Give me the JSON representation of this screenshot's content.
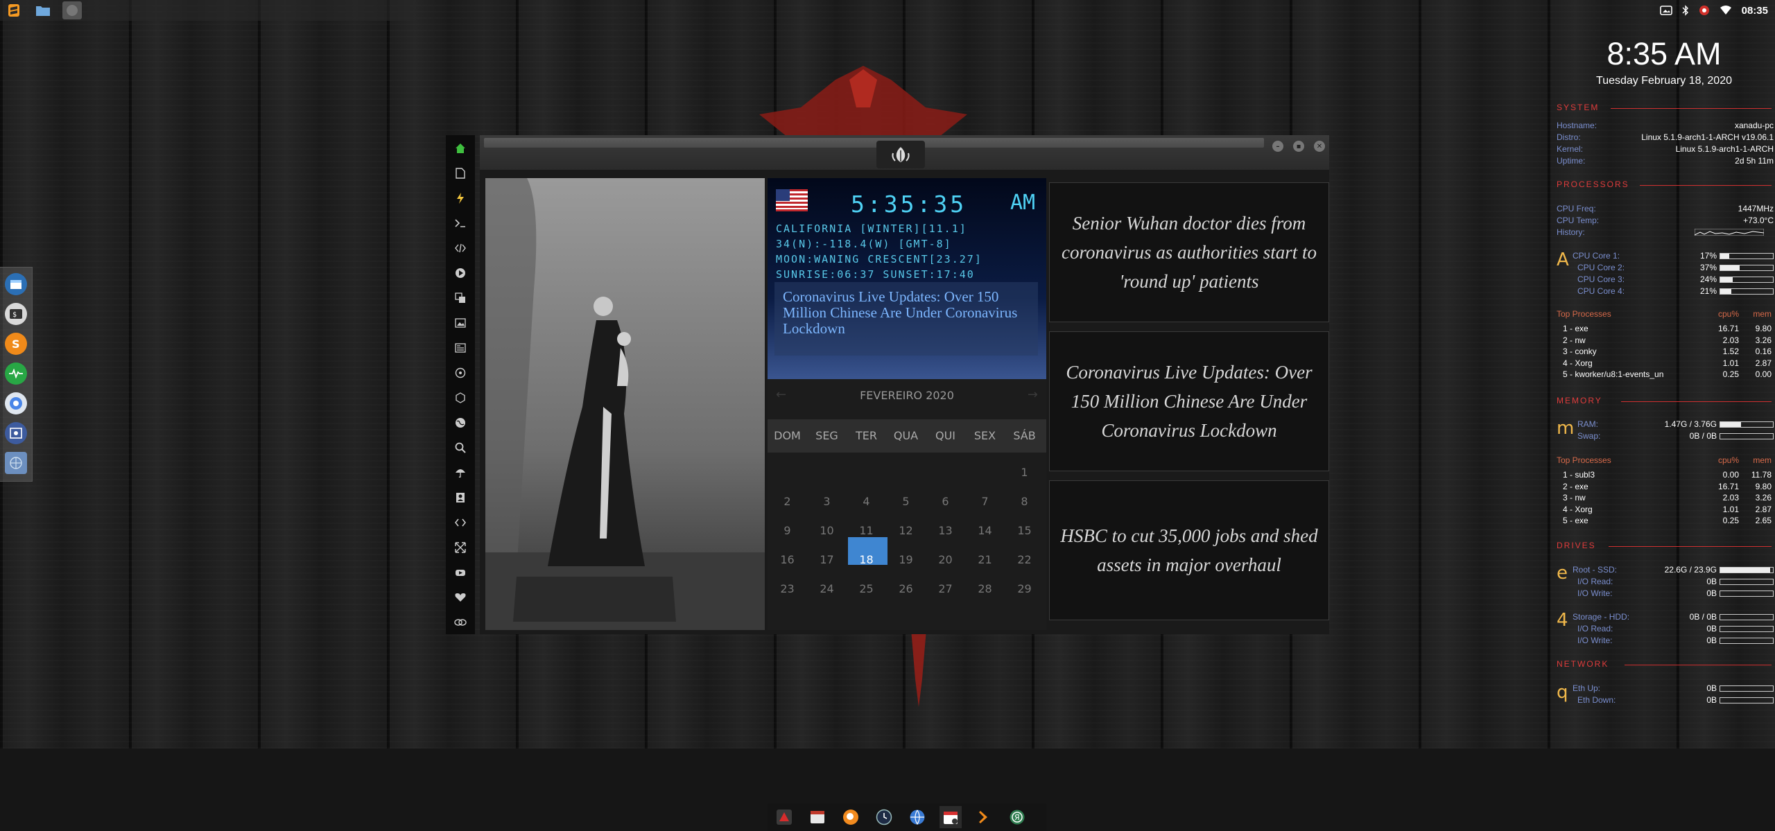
{
  "top_panel": {
    "tray_time": "08:35"
  },
  "app": {
    "weather_widget": {
      "time": "5:35:35",
      "ampm": "AM",
      "lines": [
        "CALIFORNIA [WINTER][11.1]",
        "34(N):-118.4(W) [GMT-8]",
        "MOON:WANING CRESCENT[23.27]",
        "SUNRISE:06:37 SUNSET:17:40"
      ],
      "headline": "Coronavirus Live Updates: Over 150 Million Chinese Are Under Coronavirus Lockdown"
    },
    "calendar": {
      "month": "FEVEREIRO 2020",
      "prev": "←",
      "next": "→",
      "dow": [
        "DOM",
        "SEG",
        "TER",
        "QUA",
        "QUI",
        "SEX",
        "SÁB"
      ],
      "rows": [
        [
          "",
          "",
          "",
          "",
          "",
          "",
          "1"
        ],
        [
          "2",
          "3",
          "4",
          "5",
          "6",
          "7",
          "8"
        ],
        [
          "9",
          "10",
          "11",
          "12",
          "13",
          "14",
          "15"
        ],
        [
          "16",
          "17",
          "18",
          "19",
          "20",
          "21",
          "22"
        ],
        [
          "23",
          "24",
          "25",
          "26",
          "27",
          "28",
          "29"
        ]
      ],
      "today": "18"
    },
    "news_cards": [
      "Senior Wuhan doctor dies from coronavirus as authorities start to 'round up' patients",
      "Coronavirus Live Updates: Over 150 Million Chinese Are Under Coronavirus Lockdown",
      "HSBC to cut 35,000 jobs and shed assets in major overhaul"
    ]
  },
  "conky": {
    "clock": "8:35 AM",
    "date": "Tuesday February 18, 2020",
    "system": {
      "title": "SYSTEM",
      "rows": [
        {
          "label": "Hostname:",
          "value": "xanadu-pc"
        },
        {
          "label": "Distro:",
          "value": "Linux 5.1.9-arch1-1-ARCH v19.06.1"
        },
        {
          "label": "Kernel:",
          "value": "Linux 5.1.9-arch1-1-ARCH"
        },
        {
          "label": "Uptime:",
          "value": "2d 5h 11m"
        }
      ]
    },
    "processors": {
      "title": "PROCESSORS",
      "freq_label": "CPU Freq:",
      "freq": "1447MHz",
      "temp_label": "CPU Temp:",
      "temp": "+73.0°C",
      "history_label": "History:",
      "letter": "A",
      "cores": [
        {
          "label": "CPU Core 1:",
          "value": "17%",
          "level": 0.17
        },
        {
          "label": "CPU Core 2:",
          "value": "37%",
          "level": 0.37
        },
        {
          "label": "CPU Core 3:",
          "value": "24%",
          "level": 0.24
        },
        {
          "label": "CPU Core 4:",
          "value": "21%",
          "level": 0.21
        }
      ],
      "top_header": "Top Processes",
      "cpu_header": "cpu%",
      "mem_header": "mem",
      "top": [
        {
          "name": "1  - exe",
          "cpu": "16.71",
          "mem": "9.80"
        },
        {
          "name": "2  - nw",
          "cpu": "2.03",
          "mem": "3.26"
        },
        {
          "name": "3  - conky",
          "cpu": "1.52",
          "mem": "0.16"
        },
        {
          "name": "4  - Xorg",
          "cpu": "1.01",
          "mem": "2.87"
        },
        {
          "name": "5  - kworker/u8:1-events_un",
          "cpu": "0.25",
          "mem": "0.00"
        }
      ]
    },
    "memory": {
      "title": "MEMORY",
      "letter": "m",
      "ram_label": "RAM:",
      "ram": "1.47G / 3.76G",
      "ram_level": 0.39,
      "swap_label": "Swap:",
      "swap": "0B / 0B",
      "swap_level": 0,
      "top_header": "Top Processes",
      "cpu_header": "cpu%",
      "mem_header": "mem",
      "top": [
        {
          "name": "1  - subl3",
          "cpu": "0.00",
          "mem": "11.78"
        },
        {
          "name": "2  - exe",
          "cpu": "16.71",
          "mem": "9.80"
        },
        {
          "name": "3  - nw",
          "cpu": "2.03",
          "mem": "3.26"
        },
        {
          "name": "4  - Xorg",
          "cpu": "1.01",
          "mem": "2.87"
        },
        {
          "name": "5  - exe",
          "cpu": "0.25",
          "mem": "2.65"
        }
      ]
    },
    "drives": {
      "title": "DRIVES",
      "root": {
        "letter": "e",
        "label": "Root  -  SSD:",
        "value": "22.6G / 23.9G",
        "level": 0.95,
        "read_label": "I/O Read:",
        "read": "0B",
        "write_label": "I/O Write:",
        "write": "0B"
      },
      "storage": {
        "letter": "4",
        "label": "Storage  -  HDD:",
        "value": "0B / 0B",
        "level": 0,
        "read_label": "I/O Read:",
        "read": "0B",
        "write_label": "I/O Write:",
        "write": "0B"
      }
    },
    "network": {
      "title": "NETWORK",
      "letter": "q",
      "up_label": "Eth Up:",
      "up": "0B",
      "down_label": "Eth Down:",
      "down": "0B"
    }
  }
}
